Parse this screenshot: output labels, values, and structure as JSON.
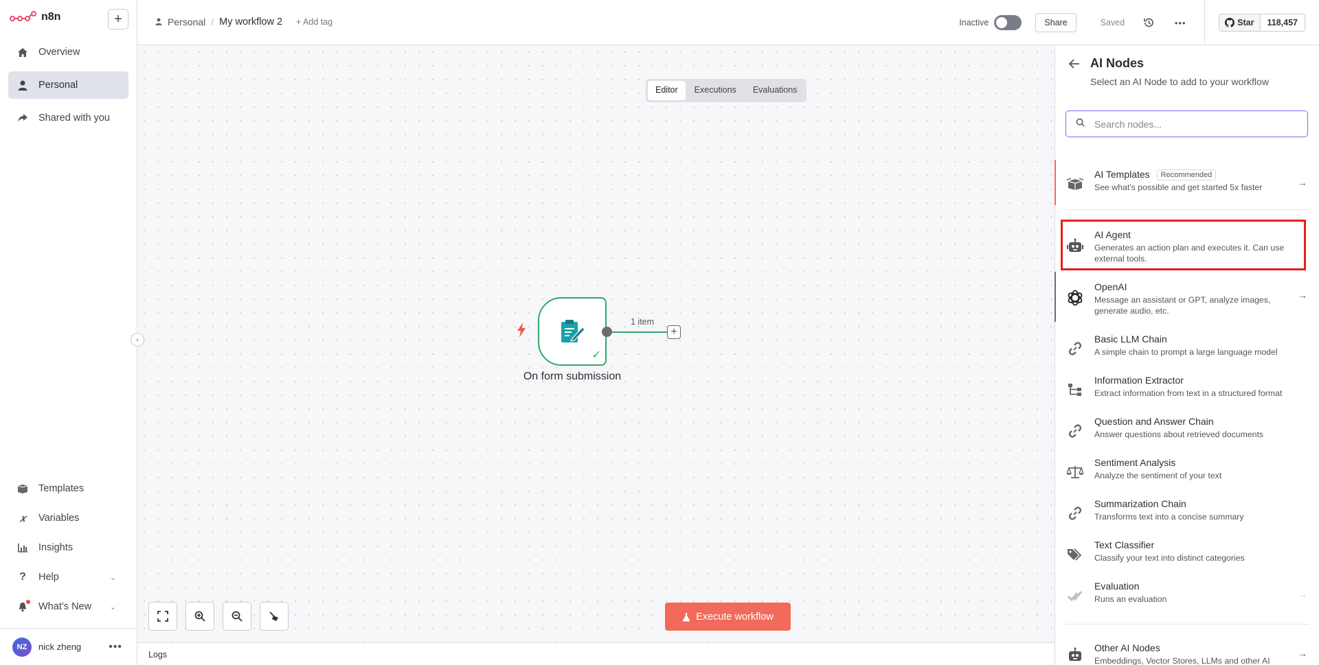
{
  "app": {
    "name": "n8n"
  },
  "sidebar": {
    "items": [
      {
        "label": "Overview",
        "icon": "home-icon"
      },
      {
        "label": "Personal",
        "icon": "person-icon"
      },
      {
        "label": "Shared with you",
        "icon": "share-icon"
      }
    ],
    "bottom_items": [
      {
        "label": "Templates",
        "icon": "box-icon"
      },
      {
        "label": "Variables",
        "icon": "variable-icon"
      },
      {
        "label": "Insights",
        "icon": "chart-icon"
      },
      {
        "label": "Help",
        "icon": "question-icon"
      },
      {
        "label": "What’s New",
        "icon": "bell-icon"
      }
    ],
    "user": {
      "initials": "NZ",
      "name": "nick zheng"
    }
  },
  "header": {
    "project": "Personal",
    "workflow_name": "My workflow 2",
    "add_tag": "+ Add tag",
    "status": "Inactive",
    "share_label": "Share",
    "saved_label": "Saved",
    "github_star": "Star",
    "github_count": "118,457"
  },
  "tabs": [
    "Editor",
    "Executions",
    "Evaluations"
  ],
  "canvas": {
    "node_label": "On form submission",
    "item_count": "1 item",
    "execute_label": "Execute workflow",
    "logs_label": "Logs"
  },
  "panel": {
    "title": "AI Nodes",
    "subtitle": "Select an AI Node to add to your workflow",
    "search_placeholder": "Search nodes...",
    "items": [
      {
        "title": "AI Templates",
        "badge": "Recommended",
        "desc": "See what's possible and get started 5x faster",
        "icon": "box-icon"
      },
      {
        "title": "AI Agent",
        "desc": "Generates an action plan and executes it. Can use external tools.",
        "icon": "robot-icon"
      },
      {
        "title": "OpenAI",
        "desc": "Message an assistant or GPT, analyze images, generate audio, etc.",
        "icon": "openai-icon"
      },
      {
        "title": "Basic LLM Chain",
        "desc": "A simple chain to prompt a large language model",
        "icon": "link-icon"
      },
      {
        "title": "Information Extractor",
        "desc": "Extract information from text in a structured format",
        "icon": "tree-icon"
      },
      {
        "title": "Question and Answer Chain",
        "desc": "Answer questions about retrieved documents",
        "icon": "link-icon"
      },
      {
        "title": "Sentiment Analysis",
        "desc": "Analyze the sentiment of your text",
        "icon": "scale-icon"
      },
      {
        "title": "Summarization Chain",
        "desc": "Transforms text into a concise summary",
        "icon": "link-icon"
      },
      {
        "title": "Text Classifier",
        "desc": "Classify your text into distinct categories",
        "icon": "tag-icon"
      },
      {
        "title": "Evaluation",
        "desc": "Runs an evaluation",
        "icon": "check-icon"
      },
      {
        "title": "Other AI Nodes",
        "desc": "Embeddings, Vector Stores, LLMs and other AI",
        "icon": "robot-icon"
      }
    ]
  },
  "colors": {
    "accent": "#f26a5b",
    "success": "#2ea76b",
    "highlight": "#e81d1d",
    "search_focus": "#7a6ef5"
  }
}
